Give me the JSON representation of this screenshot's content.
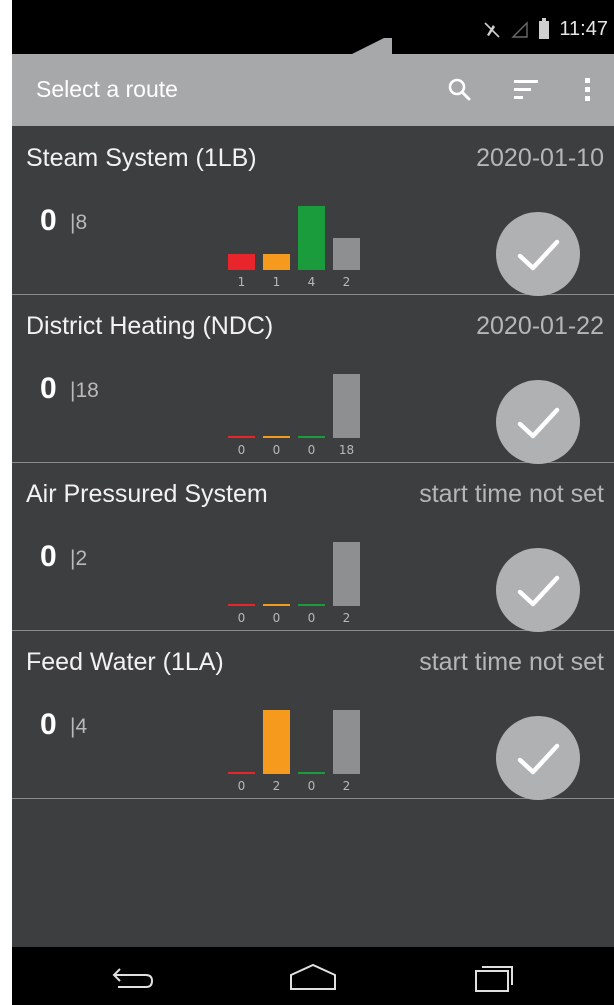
{
  "status_bar": {
    "time": "11:47",
    "icons": [
      "mute-icon",
      "signal-icon",
      "battery-icon"
    ]
  },
  "toolbar": {
    "title": "Select a route",
    "actions": [
      "search-icon",
      "sort-icon",
      "overflow-menu-icon"
    ]
  },
  "routes": [
    {
      "name": "Steam System (1LB)",
      "date": "2020-01-10",
      "count": "0",
      "total": "|8",
      "bars": [
        {
          "value": 1,
          "label": "1",
          "color": "#e8252b"
        },
        {
          "value": 1,
          "label": "1",
          "color": "#f59a1d"
        },
        {
          "value": 4,
          "label": "4",
          "color": "#1a9b3c"
        },
        {
          "value": 2,
          "label": "2",
          "color": "#8e8f91"
        }
      ]
    },
    {
      "name": "District Heating (NDC)",
      "date": "2020-01-22",
      "count": "0",
      "total": "|18",
      "bars": [
        {
          "value": 0,
          "label": "0",
          "color": "#e8252b"
        },
        {
          "value": 0,
          "label": "0",
          "color": "#f59a1d"
        },
        {
          "value": 0,
          "label": "0",
          "color": "#1a9b3c"
        },
        {
          "value": 18,
          "label": "18",
          "color": "#8e8f91"
        }
      ]
    },
    {
      "name": "Air Pressured System",
      "date": "start time not set",
      "count": "0",
      "total": "|2",
      "bars": [
        {
          "value": 0,
          "label": "0",
          "color": "#e8252b"
        },
        {
          "value": 0,
          "label": "0",
          "color": "#f59a1d"
        },
        {
          "value": 0,
          "label": "0",
          "color": "#1a9b3c"
        },
        {
          "value": 2,
          "label": "2",
          "color": "#8e8f91"
        }
      ]
    },
    {
      "name": "Feed Water (1LA)",
      "date": "start time not set",
      "count": "0",
      "total": "|4",
      "bars": [
        {
          "value": 0,
          "label": "0",
          "color": "#e8252b"
        },
        {
          "value": 2,
          "label": "2",
          "color": "#f59a1d"
        },
        {
          "value": 0,
          "label": "0",
          "color": "#1a9b3c"
        },
        {
          "value": 2,
          "label": "2",
          "color": "#8e8f91"
        }
      ]
    }
  ],
  "nav_bar": {
    "buttons": [
      "back-icon",
      "home-icon",
      "recent-apps-icon"
    ]
  }
}
